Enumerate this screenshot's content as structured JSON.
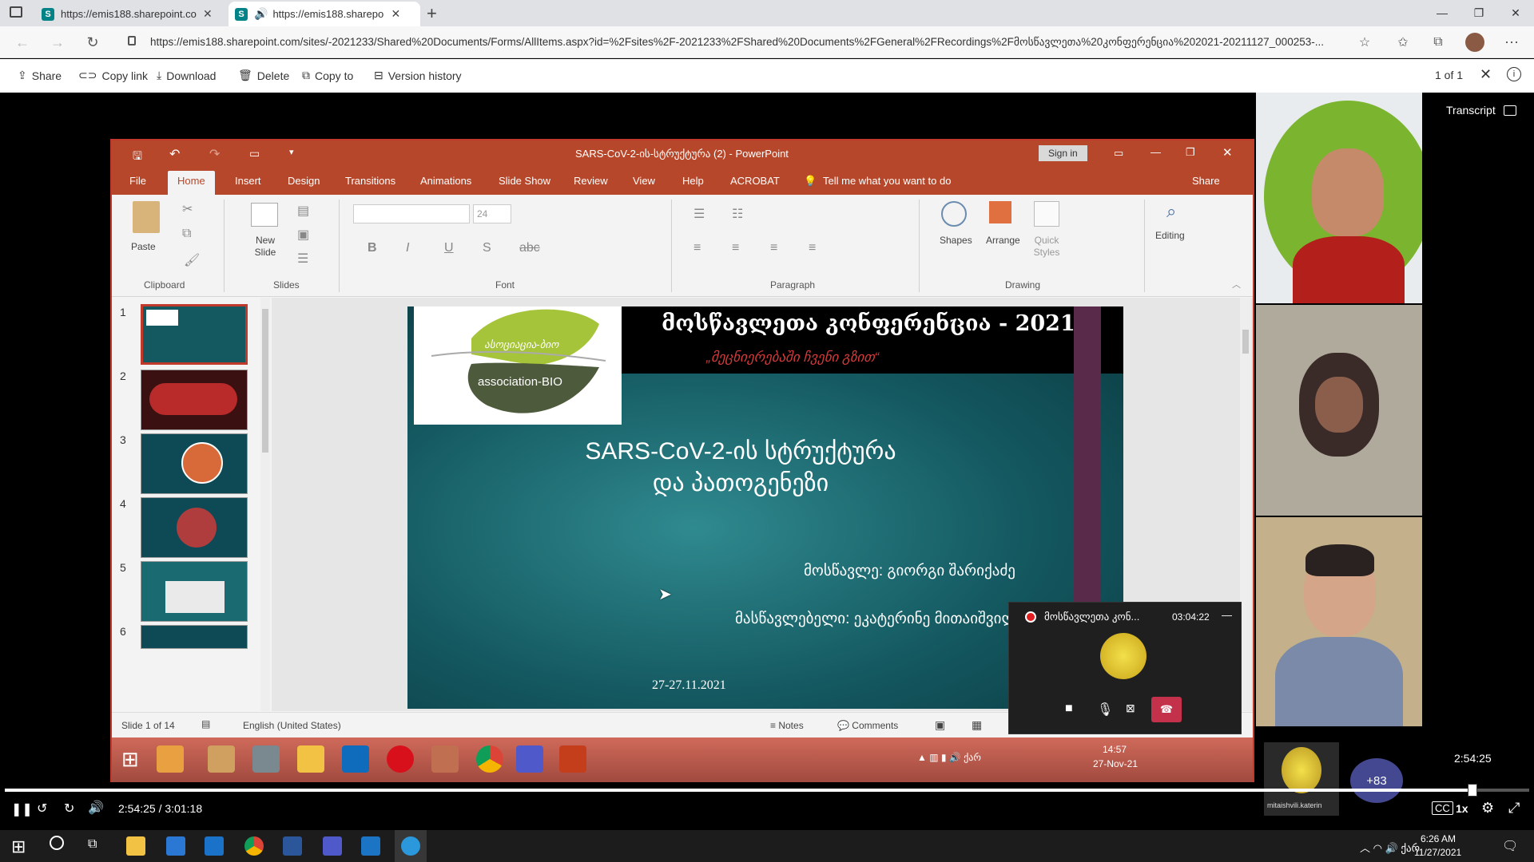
{
  "browser": {
    "tabs": [
      {
        "title": "https://emis188.sharepoint.com/",
        "active": false
      },
      {
        "title": "https://emis188.sharepoint.",
        "active": true
      }
    ],
    "url": "https://emis188.sharepoint.com/sites/-2021233/Shared%20Documents/Forms/AllItems.aspx?id=%2Fsites%2F-2021233%2FShared%20Documents%2FGeneral%2FRecordings%2Fმოსწავლეთა%20კონფერენცია%202021-20211127_000253-..."
  },
  "commandbar": {
    "share": "Share",
    "copy_link": "Copy link",
    "download": "Download",
    "delete": "Delete",
    "copy_to": "Copy to",
    "version_history": "Version history",
    "page_count": "1 of 1",
    "transcript": "Transcript"
  },
  "powerpoint": {
    "title": "SARS-CoV-2-ის-სტრუქტურა (2) - PowerPoint",
    "sign_in": "Sign in",
    "tabs": [
      "File",
      "Home",
      "Insert",
      "Design",
      "Transitions",
      "Animations",
      "Slide Show",
      "Review",
      "View",
      "Help",
      "ACROBAT"
    ],
    "tell_me": "Tell me what you want to do",
    "share": "Share",
    "ribbon": {
      "paste": "Paste",
      "new_slide": "New Slide",
      "font_size": "24",
      "shapes": "Shapes",
      "arrange": "Arrange",
      "quick_styles": "Quick Styles",
      "editing": "Editing",
      "groups": [
        "Clipboard",
        "Slides",
        "Font",
        "Paragraph",
        "Drawing"
      ]
    },
    "thumb_numbers": [
      "1",
      "2",
      "3",
      "4",
      "5",
      "6"
    ],
    "slide": {
      "header_title": "მოსწავლეთა კონფერენცია - 2021",
      "header_subtitle": "„მეცნიერებაში ჩვენი გზით“",
      "logo_top": "ასოციაცია-ბიო",
      "logo_bottom": "association-BIO",
      "title_line1": "SARS-CoV-2-ის სტრუქტურა",
      "title_line2": "და პათოგენეზი",
      "student": "მოსწავლე: გიორგი შარიქაძე",
      "teacher": "მასწავლებელი: ეკატერინე მითაიშვილი",
      "date": "27-27.11.2021"
    },
    "status": {
      "slide_count": "Slide 1 of 14",
      "language": "English (United States)",
      "notes": "Notes",
      "comments": "Comments"
    },
    "taskbar_time": "14:57",
    "taskbar_date": "27-Nov-21"
  },
  "call": {
    "title": "მოსწავლეთა კონ...",
    "timer": "03:04:22"
  },
  "participants": {
    "extra_count": "+83",
    "name_label": "mitaishvili.katerin"
  },
  "player": {
    "current_time": "2:54:25",
    "total_time": "3:01:18",
    "tooltip_time": "2:54:25",
    "speed": "1x",
    "progress": 0.963
  },
  "windows": {
    "time": "6:26 AM",
    "date": "11/27/2021"
  }
}
